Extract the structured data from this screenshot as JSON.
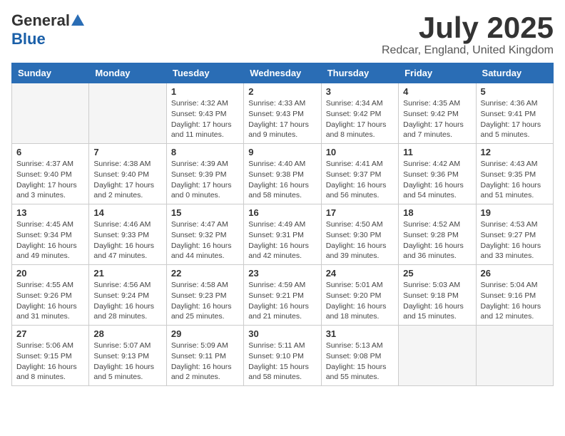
{
  "logo": {
    "general": "General",
    "blue": "Blue"
  },
  "header": {
    "month": "July 2025",
    "location": "Redcar, England, United Kingdom"
  },
  "weekdays": [
    "Sunday",
    "Monday",
    "Tuesday",
    "Wednesday",
    "Thursday",
    "Friday",
    "Saturday"
  ],
  "weeks": [
    [
      {
        "day": "",
        "info": ""
      },
      {
        "day": "",
        "info": ""
      },
      {
        "day": "1",
        "info": "Sunrise: 4:32 AM\nSunset: 9:43 PM\nDaylight: 17 hours and 11 minutes."
      },
      {
        "day": "2",
        "info": "Sunrise: 4:33 AM\nSunset: 9:43 PM\nDaylight: 17 hours and 9 minutes."
      },
      {
        "day": "3",
        "info": "Sunrise: 4:34 AM\nSunset: 9:42 PM\nDaylight: 17 hours and 8 minutes."
      },
      {
        "day": "4",
        "info": "Sunrise: 4:35 AM\nSunset: 9:42 PM\nDaylight: 17 hours and 7 minutes."
      },
      {
        "day": "5",
        "info": "Sunrise: 4:36 AM\nSunset: 9:41 PM\nDaylight: 17 hours and 5 minutes."
      }
    ],
    [
      {
        "day": "6",
        "info": "Sunrise: 4:37 AM\nSunset: 9:40 PM\nDaylight: 17 hours and 3 minutes."
      },
      {
        "day": "7",
        "info": "Sunrise: 4:38 AM\nSunset: 9:40 PM\nDaylight: 17 hours and 2 minutes."
      },
      {
        "day": "8",
        "info": "Sunrise: 4:39 AM\nSunset: 9:39 PM\nDaylight: 17 hours and 0 minutes."
      },
      {
        "day": "9",
        "info": "Sunrise: 4:40 AM\nSunset: 9:38 PM\nDaylight: 16 hours and 58 minutes."
      },
      {
        "day": "10",
        "info": "Sunrise: 4:41 AM\nSunset: 9:37 PM\nDaylight: 16 hours and 56 minutes."
      },
      {
        "day": "11",
        "info": "Sunrise: 4:42 AM\nSunset: 9:36 PM\nDaylight: 16 hours and 54 minutes."
      },
      {
        "day": "12",
        "info": "Sunrise: 4:43 AM\nSunset: 9:35 PM\nDaylight: 16 hours and 51 minutes."
      }
    ],
    [
      {
        "day": "13",
        "info": "Sunrise: 4:45 AM\nSunset: 9:34 PM\nDaylight: 16 hours and 49 minutes."
      },
      {
        "day": "14",
        "info": "Sunrise: 4:46 AM\nSunset: 9:33 PM\nDaylight: 16 hours and 47 minutes."
      },
      {
        "day": "15",
        "info": "Sunrise: 4:47 AM\nSunset: 9:32 PM\nDaylight: 16 hours and 44 minutes."
      },
      {
        "day": "16",
        "info": "Sunrise: 4:49 AM\nSunset: 9:31 PM\nDaylight: 16 hours and 42 minutes."
      },
      {
        "day": "17",
        "info": "Sunrise: 4:50 AM\nSunset: 9:30 PM\nDaylight: 16 hours and 39 minutes."
      },
      {
        "day": "18",
        "info": "Sunrise: 4:52 AM\nSunset: 9:28 PM\nDaylight: 16 hours and 36 minutes."
      },
      {
        "day": "19",
        "info": "Sunrise: 4:53 AM\nSunset: 9:27 PM\nDaylight: 16 hours and 33 minutes."
      }
    ],
    [
      {
        "day": "20",
        "info": "Sunrise: 4:55 AM\nSunset: 9:26 PM\nDaylight: 16 hours and 31 minutes."
      },
      {
        "day": "21",
        "info": "Sunrise: 4:56 AM\nSunset: 9:24 PM\nDaylight: 16 hours and 28 minutes."
      },
      {
        "day": "22",
        "info": "Sunrise: 4:58 AM\nSunset: 9:23 PM\nDaylight: 16 hours and 25 minutes."
      },
      {
        "day": "23",
        "info": "Sunrise: 4:59 AM\nSunset: 9:21 PM\nDaylight: 16 hours and 21 minutes."
      },
      {
        "day": "24",
        "info": "Sunrise: 5:01 AM\nSunset: 9:20 PM\nDaylight: 16 hours and 18 minutes."
      },
      {
        "day": "25",
        "info": "Sunrise: 5:03 AM\nSunset: 9:18 PM\nDaylight: 16 hours and 15 minutes."
      },
      {
        "day": "26",
        "info": "Sunrise: 5:04 AM\nSunset: 9:16 PM\nDaylight: 16 hours and 12 minutes."
      }
    ],
    [
      {
        "day": "27",
        "info": "Sunrise: 5:06 AM\nSunset: 9:15 PM\nDaylight: 16 hours and 8 minutes."
      },
      {
        "day": "28",
        "info": "Sunrise: 5:07 AM\nSunset: 9:13 PM\nDaylight: 16 hours and 5 minutes."
      },
      {
        "day": "29",
        "info": "Sunrise: 5:09 AM\nSunset: 9:11 PM\nDaylight: 16 hours and 2 minutes."
      },
      {
        "day": "30",
        "info": "Sunrise: 5:11 AM\nSunset: 9:10 PM\nDaylight: 15 hours and 58 minutes."
      },
      {
        "day": "31",
        "info": "Sunrise: 5:13 AM\nSunset: 9:08 PM\nDaylight: 15 hours and 55 minutes."
      },
      {
        "day": "",
        "info": ""
      },
      {
        "day": "",
        "info": ""
      }
    ]
  ]
}
